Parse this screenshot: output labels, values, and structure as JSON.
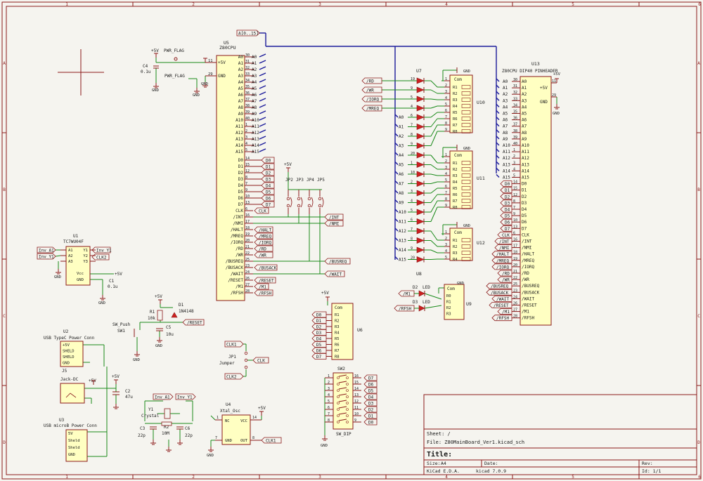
{
  "colors": {
    "background": "#f5f4ef",
    "frame": "#8b1a1a",
    "wire": "#1a8a1a",
    "bus": "#1a1a9a",
    "component_fill": "#ffffc2",
    "text": "#1a1a1a"
  },
  "frame": {
    "columns": [
      "1",
      "2",
      "3",
      "4",
      "5",
      "6"
    ],
    "rows": [
      "A",
      "B",
      "C",
      "D"
    ]
  },
  "u5": {
    "ref": "U5",
    "name": "Z80CPU",
    "left_pins": [
      "+5V",
      "GND"
    ],
    "left_nums": [
      "11",
      "29"
    ],
    "addr_pins": [
      "A0",
      "A1",
      "A2",
      "A3",
      "A4",
      "A5",
      "A6",
      "A7",
      "A8",
      "A9",
      "A10",
      "A11",
      "A12",
      "A13",
      "A14",
      "A15"
    ],
    "addr_nums": [
      "30",
      "31",
      "32",
      "33",
      "34",
      "35",
      "36",
      "37",
      "38",
      "39",
      "40",
      "1",
      "2",
      "3",
      "4",
      "5"
    ],
    "data_pins": [
      "D0",
      "D1",
      "D2",
      "D3",
      "D4",
      "D5",
      "D6",
      "D7"
    ],
    "data_nums": [
      "14",
      "15",
      "12",
      "8",
      "7",
      "9",
      "10",
      "13"
    ],
    "ctrl_pins": [
      "CLK",
      "/INT",
      "/NMI",
      "/HALT",
      "/MREQ",
      "/IORQ",
      "/RD",
      "/WR",
      "/BUSREQ",
      "/BUSACK",
      "/WAIT",
      "/RESET",
      "/M1",
      "/RFSH"
    ],
    "ctrl_nums": [
      "6",
      "16",
      "17",
      "18",
      "19",
      "20",
      "21",
      "22",
      "25",
      "23",
      "24",
      "26",
      "27",
      "28"
    ]
  },
  "u13": {
    "ref": "U13",
    "name": "Z80CPU DIP40 PINHEADER",
    "top_pins": [
      "+5V",
      "GND"
    ],
    "top_nums": [
      "11",
      "29"
    ],
    "pins": [
      "A0",
      "A1",
      "A2",
      "A3",
      "A4",
      "A5",
      "A6",
      "A7",
      "A8",
      "A9",
      "A10",
      "A11",
      "A12",
      "A13",
      "A14",
      "A15",
      "D0",
      "D1",
      "D2",
      "D3",
      "D4",
      "D5",
      "D6",
      "D7",
      "CLK",
      "/INT",
      "/NMI",
      "/HALT",
      "/MREQ",
      "/IORQ",
      "/RD",
      "/WR",
      "/BUSREQ",
      "/BUSACK",
      "/WAIT",
      "/RESET",
      "/M1",
      "/RFSH"
    ],
    "nums": [
      "30",
      "31",
      "32",
      "33",
      "34",
      "35",
      "36",
      "37",
      "38",
      "39",
      "40",
      "1",
      "2",
      "3",
      "4",
      "5",
      "14",
      "15",
      "12",
      "8",
      "7",
      "9",
      "10",
      "13",
      "6",
      "16",
      "17",
      "18",
      "19",
      "20",
      "21",
      "22",
      "25",
      "23",
      "24",
      "26",
      "27",
      "28"
    ],
    "net_labels": [
      "A0",
      "A1",
      "A2",
      "A3",
      "A4",
      "A5",
      "A6",
      "A7",
      "A8",
      "A9",
      "A10",
      "A11",
      "A12",
      "A13",
      "A14",
      "A15",
      "D0",
      "D1",
      "D2",
      "D3",
      "D4",
      "D5",
      "D6",
      "D7",
      "CLK",
      "/INT",
      "/NMI",
      "/HALT",
      "/MREQ",
      "/IORQ",
      "/RD",
      "/WR",
      "/BUSREQ",
      "/BUSACK",
      "/WAIT",
      "/RESET",
      "/M1",
      "/RFSH"
    ]
  },
  "bus_label": "A[0..15]",
  "u5_addr_labels": [
    "A0",
    "A1",
    "A2",
    "A3",
    "A4",
    "A5",
    "A6",
    "A7",
    "A8",
    "A9",
    "A10",
    "A11",
    "A12",
    "A13",
    "A14",
    "A15"
  ],
  "u5_data_labels": [
    "D0",
    "D1",
    "D2",
    "D3",
    "D4",
    "D5",
    "D6",
    "D7"
  ],
  "u5_ctrl_labels": {
    "clk": "CLK",
    "halt": "/HALT",
    "mreq": "/MREQ",
    "iorq": "/IORQ",
    "rd": "/RD",
    "wr": "/WR",
    "busack": "/BUSACK",
    "reset": "/RESET",
    "m1": "/M1",
    "rfsh": "/RFSH"
  },
  "jumpers": {
    "power": "+5V",
    "refs": [
      "JP2",
      "JP3",
      "JP4",
      "JP5"
    ],
    "outputs": [
      "/INT",
      "/NMI",
      "/BUSREQ",
      "/WAIT"
    ]
  },
  "power": {
    "c4_ref": "C4",
    "c4_val": "0.1u",
    "pwr_flag": "PWR_FLAG",
    "vcc": "+5V",
    "gnd": "GND"
  },
  "led_array": {
    "u7": "U7",
    "u8": "U8",
    "ctrl_inputs": [
      "/RD",
      "/WR",
      "/IORQ",
      "/MREQ"
    ],
    "ctrl_nums": [
      "19",
      "9",
      "5",
      "4"
    ],
    "addr_inputs": [
      "A0",
      "A1",
      "A2",
      "A3",
      "A4",
      "A5",
      "A6",
      "A7",
      "A8",
      "A9",
      "A10",
      "A11",
      "A12",
      "A13",
      "A14",
      "A15"
    ],
    "addr_nums": [
      "6",
      "7",
      "8",
      "9",
      "20",
      "1",
      "10",
      "2",
      "3",
      "4",
      "5",
      "6",
      "7",
      "8",
      "9",
      "20"
    ],
    "u10": "U10",
    "u11": "U11",
    "u12": "U12",
    "com": "Com",
    "r_names": [
      "R1",
      "R2",
      "R3",
      "R4",
      "R5",
      "R6",
      "R7",
      "R8"
    ],
    "gnd": "GND",
    "u10_nums": [
      "1",
      "2",
      "3",
      "4",
      "5",
      "6",
      "7",
      "8",
      "9"
    ],
    "u11_nums": [
      "1",
      "2",
      "3",
      "4",
      "5",
      "6",
      "7",
      "8",
      "9"
    ],
    "u12_nums": [
      "1",
      "2",
      "3",
      "4",
      "5"
    ]
  },
  "status_leds": {
    "d2": "D2",
    "d3": "D3",
    "led": "LED",
    "m1": "/M1",
    "rfsh": "/RFSH",
    "u9": "U9",
    "com": "Com",
    "r_names": [
      "R0",
      "R1",
      "R2",
      "R3"
    ],
    "gnd": "GND"
  },
  "u6": {
    "ref": "U6",
    "vcc": "+5V",
    "com": "Com",
    "r_names": [
      "R1",
      "R2",
      "R3",
      "R4",
      "R5",
      "R6",
      "R7",
      "R8"
    ],
    "labels": [
      "D0",
      "D1",
      "D2",
      "D3",
      "D4",
      "D5",
      "D6",
      "D7"
    ]
  },
  "sw2": {
    "ref": "SW2",
    "value": "SW_DIP",
    "labels": [
      "D7",
      "D6",
      "D5",
      "D4",
      "D3",
      "D2",
      "D1",
      "D0"
    ],
    "nums_l": [
      "1",
      "2",
      "3",
      "4",
      "5",
      "6",
      "7",
      "8"
    ],
    "nums_r": [
      "16",
      "15",
      "14",
      "13",
      "12",
      "11",
      "10",
      "9"
    ],
    "gnd": "GND"
  },
  "u1": {
    "ref": "U1",
    "name": "TC7WU04F",
    "in_labels": [
      "Inv_A1",
      "Inv_Y1"
    ],
    "pins_l": [
      "A1",
      "A2",
      "A3"
    ],
    "pins_r": [
      "Y1",
      "Y2",
      "Y3"
    ],
    "out_labels": [
      "Inv_Y1",
      "CLK2"
    ],
    "vcc": "Vcc",
    "gnd_pin": "GND",
    "c1_ref": "C1",
    "c1_val": "0.1u",
    "v5": "+5V",
    "gnd": "GND"
  },
  "reset_circuit": {
    "v5": "+5V",
    "r1_ref": "R1",
    "r1_val": "10k",
    "d1_ref": "D1",
    "d1_val": "1N4148",
    "sw_ref": "SW_Push",
    "sw1": "SW1",
    "c5_ref": "C5",
    "c5_val": "10u",
    "reset_label": "/RESET",
    "gnd": "GND"
  },
  "usb": {
    "u2_ref": "U2",
    "u2_name": "USB TypeC Power Conn",
    "u2_pins": [
      "+5V",
      "SHELD",
      "SHELD",
      "GND"
    ],
    "j5_ref": "J5",
    "j5_name": "Jack-DC",
    "u3_ref": "U3",
    "u3_name": "USB microB Power Conn",
    "u3_pins": [
      "5V",
      "Sheld",
      "Sheld",
      "GND"
    ],
    "c2_ref": "C2",
    "c2_val": "47u",
    "v5": "+5V"
  },
  "jp1": {
    "ref": "JP1",
    "name": "Jumper",
    "in1": "CLK1",
    "in2": "CLK2",
    "out": "CLK"
  },
  "crystal": {
    "inv_a1": "Inv_A1",
    "inv_y1": "Inv_Y1",
    "y1": "Y1",
    "name": "Crystal",
    "r2": "R2",
    "r2_val": "10M",
    "c3": "C3",
    "c3_val": "22p",
    "c6": "C6",
    "c6_val": "22p"
  },
  "u4": {
    "ref": "U4",
    "name": "Xtal_Osc",
    "pins": [
      "NC",
      "VCC",
      "GND",
      "OUT"
    ],
    "nums": [
      "1",
      "14",
      "7",
      "8"
    ],
    "v5": "+5V",
    "out_label": "CLK1",
    "gnd": "GND"
  },
  "title_block": {
    "sheet": "Sheet: /",
    "file": "File: Z80MainBoard_Ver1.kicad_sch",
    "title_label": "Title:",
    "size_label": "Size:",
    "size": "A4",
    "date_label": "Date:",
    "rev_label": "Rev:",
    "tool": "KiCad E.D.A.",
    "version": "kicad 7.0.9",
    "id": "Id: 1/1"
  }
}
